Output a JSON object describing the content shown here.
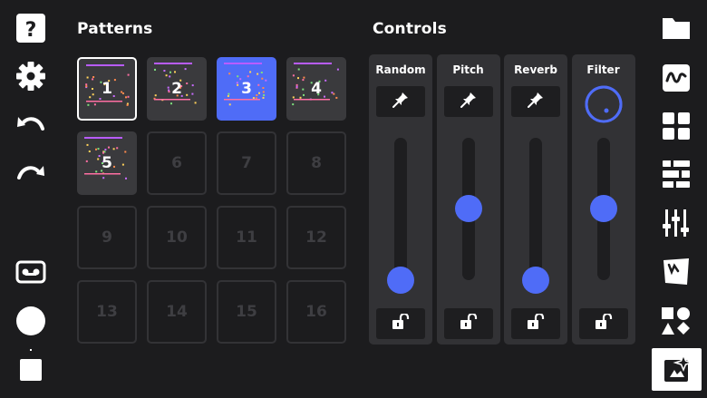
{
  "headers": {
    "patterns": "Patterns",
    "controls": "Controls"
  },
  "patterns": [
    {
      "label": "1",
      "state": "selected"
    },
    {
      "label": "2",
      "state": "filled"
    },
    {
      "label": "3",
      "state": "active"
    },
    {
      "label": "4",
      "state": "filled"
    },
    {
      "label": "5",
      "state": "filled"
    },
    {
      "label": "6",
      "state": "empty"
    },
    {
      "label": "7",
      "state": "empty"
    },
    {
      "label": "8",
      "state": "empty"
    },
    {
      "label": "9",
      "state": "empty"
    },
    {
      "label": "10",
      "state": "empty"
    },
    {
      "label": "11",
      "state": "empty"
    },
    {
      "label": "12",
      "state": "empty"
    },
    {
      "label": "13",
      "state": "empty"
    },
    {
      "label": "14",
      "state": "empty"
    },
    {
      "label": "15",
      "state": "empty"
    },
    {
      "label": "16",
      "state": "empty"
    }
  ],
  "controls": [
    {
      "label": "Random",
      "top_control": "pin-icon",
      "level": 0.0
    },
    {
      "label": "Pitch",
      "top_control": "pin-icon",
      "level": 0.6
    },
    {
      "label": "Reverb",
      "top_control": "pin-icon",
      "level": 0.0
    },
    {
      "label": "Filter",
      "top_control": "knob-icon",
      "level": 0.6
    }
  ],
  "left_toolbar": [
    "help-icon",
    "settings-gear-icon",
    "undo-icon",
    "redo-icon",
    "tape-icon",
    "record-icon",
    "stop-icon"
  ],
  "right_toolbar": [
    "folder-icon",
    "waveform-icon",
    "grid-icon",
    "sequencer-icon",
    "mixer-sliders-icon",
    "drum-pad-icon",
    "shapes-icon",
    "effects-sparkle-icon"
  ],
  "colors": {
    "accent": "#4f6cf7",
    "background": "#1c1c1e",
    "panel": "#323235"
  }
}
